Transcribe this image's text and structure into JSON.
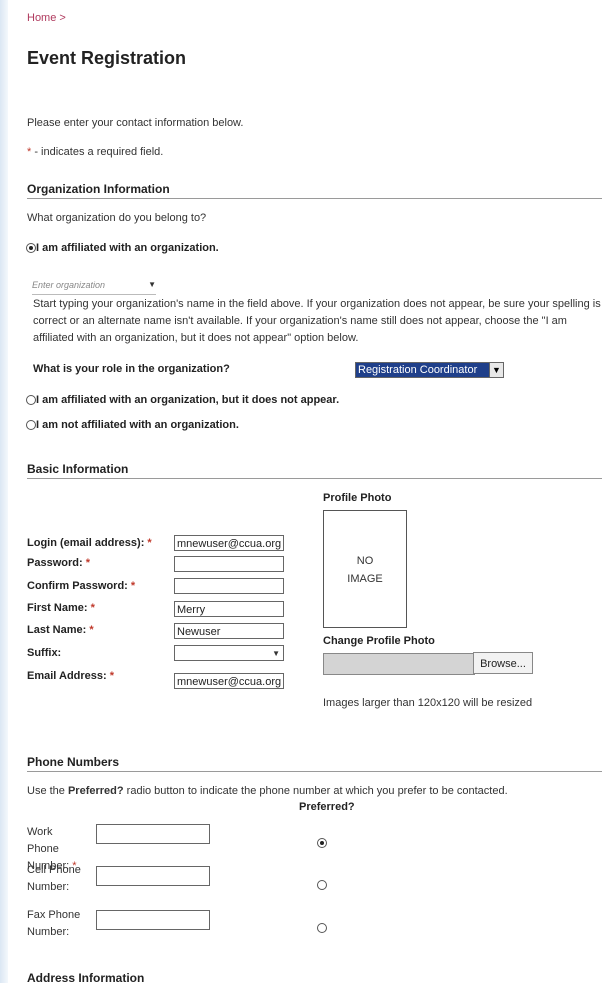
{
  "breadcrumb": "Home >",
  "page_title": "Event Registration",
  "intro": "Please enter your contact information below.",
  "required_mark": "*",
  "required_note": " - indicates a required field.",
  "org": {
    "heading": "Organization Information",
    "question": "What organization do you belong to?",
    "option_affiliated": "I am affiliated with an organization.",
    "org_placeholder": "Enter organization",
    "help_text": "Start typing your organization's name in the field above. If your organization does not appear, be sure your spelling is correct or an alternate name isn't available. If your organization's name still does not appear, choose the \"I am affiliated with an organization, but it does not appear\" option below.",
    "role_label": "What is your role in the organization?",
    "role_value": "Registration Coordinator",
    "option_not_listed": "I am affiliated with an organization, but it does not appear.",
    "option_not_affiliated": "I am not affiliated with an organization."
  },
  "basic": {
    "heading": "Basic Information",
    "profile_photo_label": "Profile Photo",
    "no_image_line1": "NO",
    "no_image_line2": "IMAGE",
    "change_photo_label": "Change Profile Photo",
    "browse_label": "Browse...",
    "resize_note": "Images larger than 120x120 will be resized",
    "fields": {
      "login": {
        "label": "Login (email address):",
        "value": "mnewuser@ccua.org"
      },
      "password": {
        "label": "Password:",
        "value": ""
      },
      "confirm_password": {
        "label": "Confirm Password:",
        "value": ""
      },
      "first_name": {
        "label": "First Name:",
        "value": "Merry"
      },
      "last_name": {
        "label": "Last Name:",
        "value": "Newuser"
      },
      "suffix": {
        "label": "Suffix:",
        "value": ""
      },
      "email": {
        "label": "Email Address:",
        "value": "mnewuser@ccua.org"
      }
    }
  },
  "phone": {
    "heading": "Phone Numbers",
    "instruction_pre": "Use the ",
    "instruction_bold": "Preferred?",
    "instruction_post": " radio button to indicate the phone number at which you prefer to be contacted.",
    "preferred_header": "Preferred?",
    "work_label": "Work Phone Number:",
    "cell_label": "Cell Phone Number:",
    "fax_label": "Fax Phone Number:"
  },
  "address": {
    "heading": "Address Information"
  }
}
